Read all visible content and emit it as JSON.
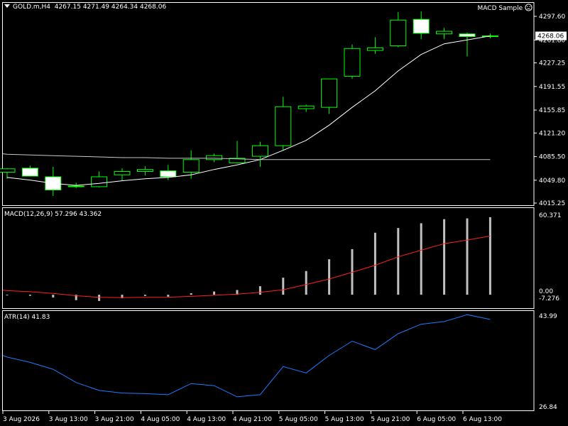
{
  "header": {
    "symbol": "GOLD.m,H4",
    "ohlc": "4267.15 4271.49 4264.34 4268.06"
  },
  "expert": {
    "name": "MACD Sample",
    "icon": "frown-face-icon"
  },
  "price_axis": {
    "ticks": [
      "4297.60",
      "4261.80",
      "4227.25",
      "4191.55",
      "4155.85",
      "4121.20",
      "4085.50",
      "4049.80",
      "4015.25"
    ],
    "current_price": "4268.06"
  },
  "time_axis": {
    "labels": [
      "3 Aug 2026",
      "3 Aug 13:00",
      "3 Aug 21:00",
      "4 Aug 05:00",
      "4 Aug 13:00",
      "4 Aug 21:00",
      "5 Aug 05:00",
      "5 Aug 13:00",
      "5 Aug 21:00",
      "6 Aug 05:00",
      "6 Aug 13:00"
    ]
  },
  "macd_panel": {
    "label": "MACD(12,26,9) 57.296 43.362",
    "ticks": [
      "60.371",
      "0.00",
      "-7.276"
    ]
  },
  "atr_panel": {
    "label": "ATR(14) 41.83",
    "ticks": [
      "43.99",
      "26.84"
    ]
  },
  "colors": {
    "bull_candle": "#00ff00",
    "bear_body": "#ffffff",
    "ma_fast": "#ffffff",
    "ma_slow": "#c8c8c8",
    "macd_signal": "#ff2020",
    "macd_hist": "#c0c0c0",
    "atr_line": "#1e7bff"
  },
  "chart_data": [
    {
      "type": "candlestick",
      "title": "GOLD.m,H4",
      "x": [
        "3 Aug 2026 01:00",
        "3 Aug 05:00",
        "3 Aug 09:00",
        "3 Aug 13:00",
        "3 Aug 17:00",
        "3 Aug 21:00",
        "4 Aug 01:00",
        "4 Aug 05:00",
        "4 Aug 09:00",
        "4 Aug 13:00",
        "4 Aug 17:00",
        "4 Aug 21:00",
        "5 Aug 01:00",
        "5 Aug 05:00",
        "5 Aug 09:00",
        "5 Aug 13:00",
        "5 Aug 17:00",
        "5 Aug 21:00",
        "6 Aug 01:00",
        "6 Aug 05:00",
        "6 Aug 09:00",
        "6 Aug 13:00"
      ],
      "open": [
        4062,
        4068,
        4055,
        4040,
        4040,
        4058,
        4063,
        4064,
        4062,
        4081,
        4076,
        4086,
        4102,
        4158,
        4160,
        4207,
        4246,
        4253,
        4293,
        4271,
        4271,
        4267.15
      ],
      "high": [
        4068,
        4072,
        4070,
        4046,
        4063,
        4068,
        4071,
        4073,
        4095,
        4090,
        4109,
        4108,
        4176,
        4164,
        4186,
        4255,
        4266,
        4304,
        4305,
        4280,
        4273,
        4271.49
      ],
      "low": [
        4052,
        4058,
        4026,
        4038,
        4039,
        4049,
        4057,
        4050,
        4052,
        4077,
        4075,
        4070,
        4095,
        4153,
        4150,
        4203,
        4241,
        4251,
        4263,
        4263,
        4237,
        4264.34
      ],
      "close": [
        4067,
        4056,
        4035,
        4041,
        4055,
        4063,
        4066,
        4055,
        4081,
        4087,
        4083,
        4102,
        4161,
        4162,
        4203,
        4249,
        4250,
        4292,
        4272,
        4275,
        4267,
        4268.06
      ],
      "overlays": [
        {
          "name": "fast MA",
          "values": [
            4054,
            4050,
            4045,
            4042,
            4045,
            4049,
            4052,
            4054,
            4058,
            4066,
            4073,
            4081,
            4095,
            4110,
            4133,
            4160,
            4185,
            4215,
            4240,
            4256,
            4262,
            4268
          ]
        },
        {
          "name": "slow MA",
          "values": [
            4089,
            4088,
            4087,
            4086,
            4085,
            4084,
            4084,
            4083,
            4083,
            4083,
            4082,
            4081,
            4081,
            4081,
            4081,
            4081,
            4081,
            4081,
            4081,
            4081,
            4081,
            4081
          ]
        }
      ],
      "ylim": [
        4015.25,
        4297.6
      ]
    },
    {
      "type": "bar",
      "title": "MACD(12,26,9)",
      "categories": [
        "3 Aug 2026 01:00",
        "3 Aug 05:00",
        "3 Aug 09:00",
        "3 Aug 13:00",
        "3 Aug 17:00",
        "3 Aug 21:00",
        "4 Aug 01:00",
        "4 Aug 05:00",
        "4 Aug 09:00",
        "4 Aug 13:00",
        "4 Aug 17:00",
        "4 Aug 21:00",
        "5 Aug 01:00",
        "5 Aug 05:00",
        "5 Aug 09:00",
        "5 Aug 13:00",
        "5 Aug 17:00",
        "5 Aug 21:00",
        "6 Aug 01:00",
        "6 Aug 05:00",
        "6 Aug 09:00",
        "6 Aug 13:00"
      ],
      "series": [
        {
          "name": "MACD",
          "type": "bar",
          "values": [
            -0.5,
            -0.8,
            -2.0,
            -4.0,
            -4.6,
            -2.6,
            -0.9,
            -1.4,
            1.1,
            2.4,
            3.5,
            6.3,
            12.6,
            17.5,
            26.2,
            33.7,
            45.8,
            49.3,
            52.8,
            55.8,
            56.4,
            57.296
          ]
        },
        {
          "name": "Signal",
          "type": "line",
          "values": [
            3.0,
            2.2,
            1.0,
            -0.7,
            -1.9,
            -2.1,
            -1.9,
            -1.8,
            -1.2,
            -0.4,
            0.5,
            1.8,
            3.7,
            7.5,
            11.6,
            16.6,
            21.8,
            28.0,
            32.9,
            37.7,
            40.4,
            43.362
          ]
        }
      ],
      "ylim": [
        -7.276,
        60.371
      ]
    },
    {
      "type": "line",
      "title": "ATR(14)",
      "x": [
        "3 Aug 2026 01:00",
        "3 Aug 05:00",
        "3 Aug 09:00",
        "3 Aug 13:00",
        "3 Aug 17:00",
        "3 Aug 21:00",
        "4 Aug 01:00",
        "4 Aug 05:00",
        "4 Aug 09:00",
        "4 Aug 13:00",
        "4 Aug 17:00",
        "4 Aug 21:00",
        "5 Aug 01:00",
        "5 Aug 05:00",
        "5 Aug 09:00",
        "5 Aug 13:00",
        "5 Aug 17:00",
        "5 Aug 21:00",
        "6 Aug 01:00",
        "6 Aug 05:00",
        "6 Aug 09:00",
        "6 Aug 13:00"
      ],
      "series": [
        {
          "name": "ATR",
          "values": [
            36.1,
            35.1,
            33.8,
            31.3,
            29.8,
            29.3,
            29.2,
            29.0,
            31.1,
            30.7,
            28.6,
            29.0,
            34.3,
            33.1,
            36.4,
            39.1,
            37.5,
            40.5,
            42.3,
            42.8,
            44.1,
            43.2
          ]
        }
      ],
      "ylim": [
        26.84,
        43.99
      ]
    }
  ]
}
